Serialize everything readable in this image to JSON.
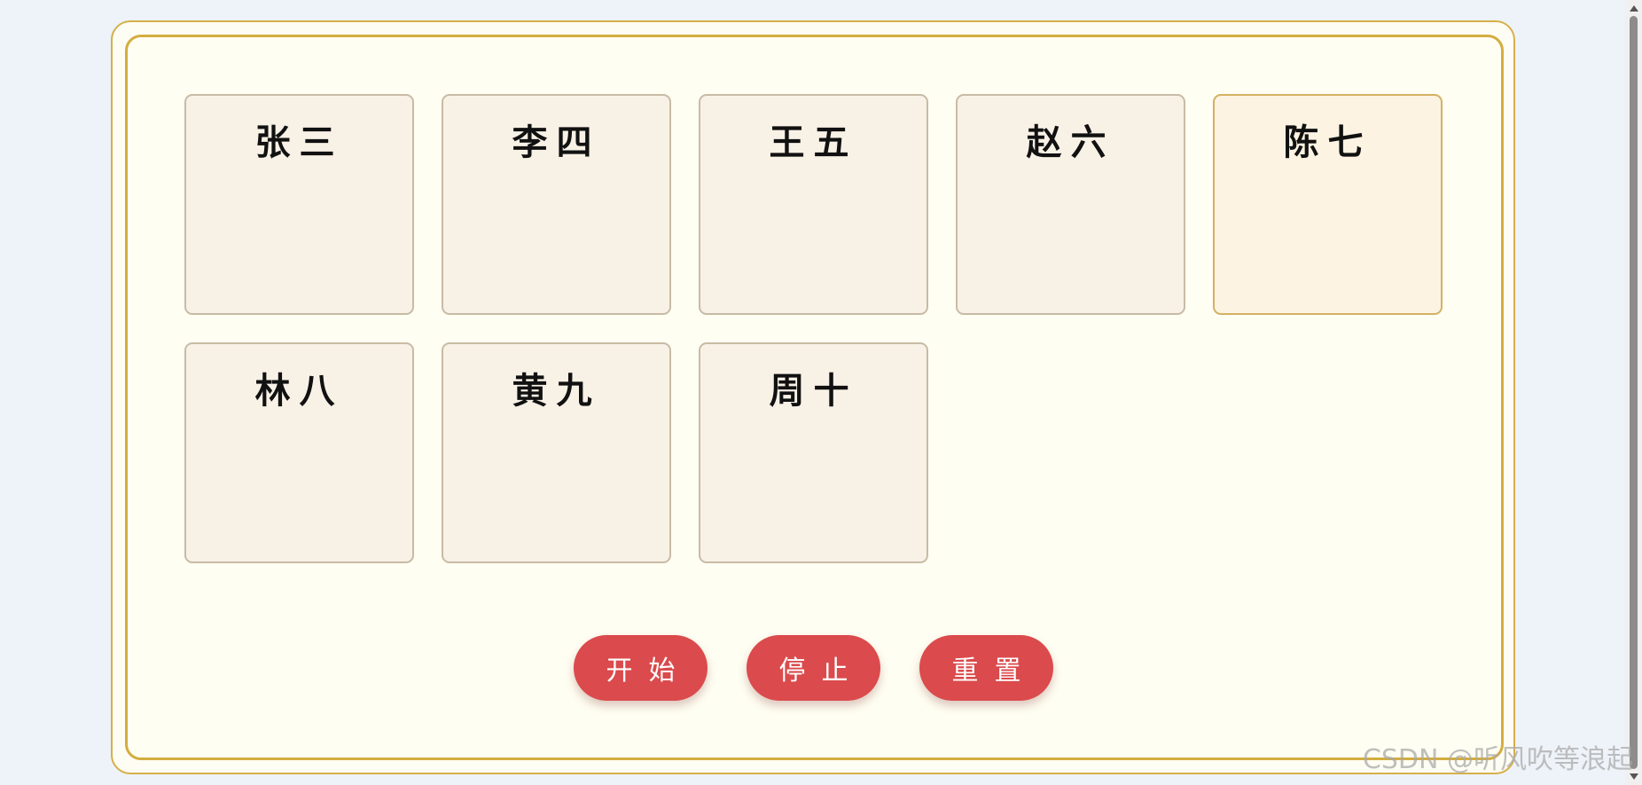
{
  "cards": [
    {
      "name": "张三"
    },
    {
      "name": "李四"
    },
    {
      "name": "王五"
    },
    {
      "name": "赵六"
    },
    {
      "name": "陈七"
    },
    {
      "name": "林八"
    },
    {
      "name": "黄九"
    },
    {
      "name": "周十"
    }
  ],
  "buttons": {
    "start": "开始",
    "stop": "停止",
    "reset": "重置"
  },
  "watermark": "CSDN @听风吹等浪起",
  "colors": {
    "button": "#db4a4c",
    "frame_border": "#d3ad3f",
    "card_bg": "#f8f1e6",
    "page_bg": "#eef3f9"
  }
}
